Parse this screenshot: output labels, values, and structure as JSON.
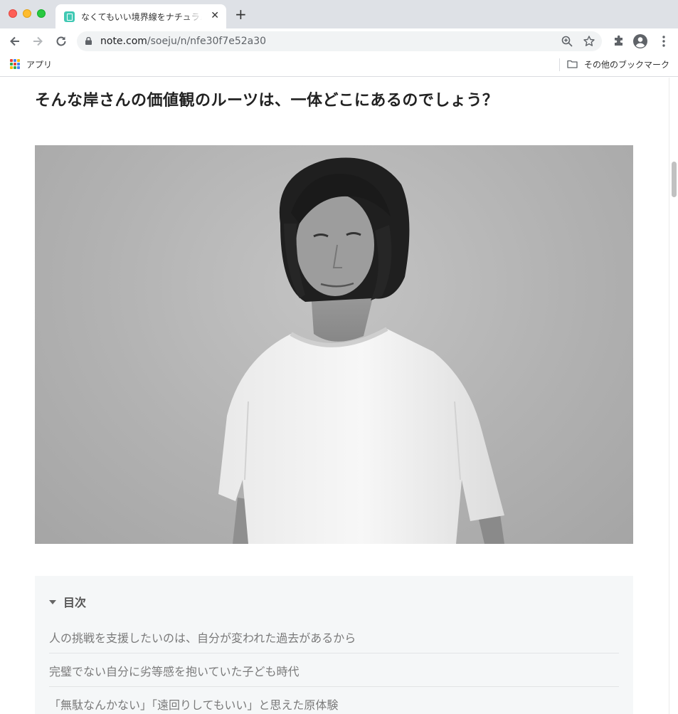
{
  "browser": {
    "tab": {
      "title": "なくてもいい境界線をナチュラルに",
      "close": "✕"
    },
    "new_tab": "+",
    "url_host": "note.com",
    "url_path": "/soeju/n/nfe30f7e52a30",
    "bookmarks": {
      "apps_label": "アプリ",
      "other_label": "その他のブックマーク"
    }
  },
  "article": {
    "heading": "そんな岸さんの価値観のルーツは、一体どこにあるのでしょう？",
    "toc": {
      "title": "目次",
      "items": [
        "人の挑戦を支援したいのは、自分が変われた過去があるから",
        "完璧でない自分に劣等感を抱いていた子ども時代",
        "「無駄なんかない」「遠回りしてもいい」と思えた原体験"
      ]
    }
  },
  "colors": {
    "tabstrip": "#dee1e6",
    "toc_background": "#f5f7f8",
    "favicon": "#41c9b4"
  }
}
